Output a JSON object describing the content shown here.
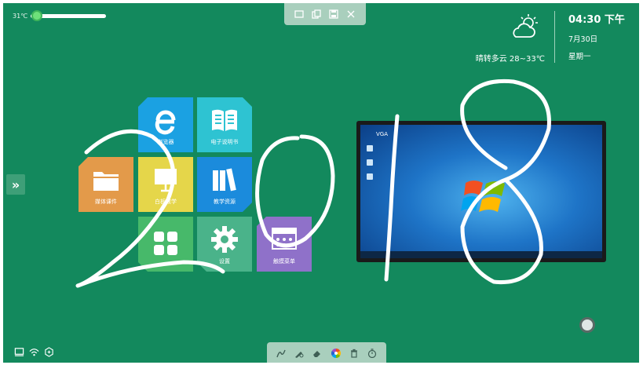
{
  "slider": {
    "label": "31℃",
    "level": 0.08
  },
  "top_toolbar": {
    "icons": [
      "minimize-window-icon",
      "copy-icon",
      "save-icon",
      "close-icon"
    ]
  },
  "weather": {
    "icon": "partly-cloudy-sun-icon",
    "text": "晴转多云  28~33℃"
  },
  "clock": {
    "time": "04:30 下午",
    "date": "7月30日",
    "weekday": "星期一"
  },
  "sidebar": {
    "expand_icon": "»"
  },
  "tiles": [
    {
      "label": "浏览器",
      "color": "#1ba1e2"
    },
    {
      "label": "电子说明书",
      "color": "#2ec3d2"
    },
    {
      "label": "媒体课件",
      "color": "#e39a4a"
    },
    {
      "label": "白板教学",
      "color": "#e5d64a"
    },
    {
      "label": "教学资源",
      "color": "#1b8bdc"
    },
    {
      "label": "",
      "color": "#47b96a"
    },
    {
      "label": "设置",
      "color": "#4ab38a"
    },
    {
      "label": "触摸菜单",
      "color": "#8f71c9"
    }
  ],
  "monitor": {
    "source_label": "VGA"
  },
  "bottom_toolbar": {
    "icons": [
      "pen-icon",
      "pen-settings-icon",
      "eraser-icon",
      "color-wheel-icon",
      "trash-icon",
      "timer-icon"
    ]
  },
  "status_icons": [
    "computer-icon",
    "wifi-icon",
    "network-icon"
  ],
  "colors": {
    "background": "#13895d",
    "toolbar": "#a9cfbd",
    "ink": "#ffffff"
  }
}
